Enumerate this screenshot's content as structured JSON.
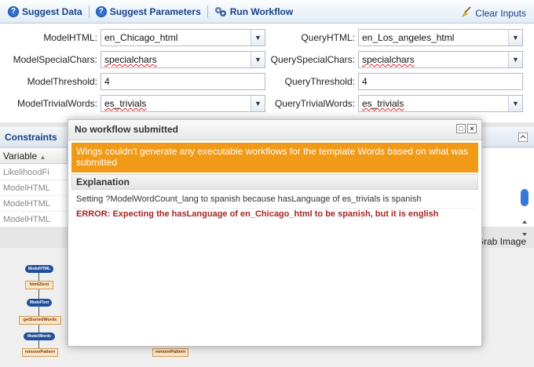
{
  "toolbar": {
    "suggest_data": "Suggest Data",
    "suggest_parameters": "Suggest Parameters",
    "run_workflow": "Run Workflow",
    "clear_inputs": "Clear Inputs"
  },
  "form": {
    "model_html": {
      "label": "ModelHTML:",
      "value": "en_Chicago_html"
    },
    "query_html": {
      "label": "QueryHTML:",
      "value": "en_Los_angeles_html"
    },
    "model_special": {
      "label": "ModelSpecialChars:",
      "value": "specialchars"
    },
    "query_special": {
      "label": "QuerySpecialChars:",
      "value": "specialchars"
    },
    "model_threshold": {
      "label": "ModelThreshold:",
      "value": "4"
    },
    "query_threshold": {
      "label": "QueryThreshold:",
      "value": "4"
    },
    "model_trivial": {
      "label": "ModelTrivialWords:",
      "value": "es_trivials"
    },
    "query_trivial": {
      "label": "QueryTrivialWords:",
      "value": "es_trivials"
    }
  },
  "constraints": {
    "title": "Constraints",
    "column": "Variable",
    "rows": [
      "LikelihoodFi",
      "ModelHTML",
      "ModelHTML",
      "ModelHTML"
    ]
  },
  "grab_image": "Grab Image",
  "graph": {
    "nodes": [
      "ModelHTML",
      "html2text",
      "ModelText",
      "getSortedWords",
      "ModelWords",
      "removePattern",
      "removePattern"
    ]
  },
  "modal": {
    "title": "No workflow submitted",
    "banner": "Wings couldn't generate any executable workflows for the template Words based on what was submitted",
    "explanation_header": "Explanation",
    "message_info": "Setting ?ModelWordCount_lang to spanish because hasLanguage of es_trivials is spanish",
    "message_error": "ERROR: Expecting the hasLanguage of en_Chicago_html to be spanish, but it is english"
  },
  "colors": {
    "accent": "#15428b",
    "banner": "#f09a18",
    "error": "#a62424"
  }
}
